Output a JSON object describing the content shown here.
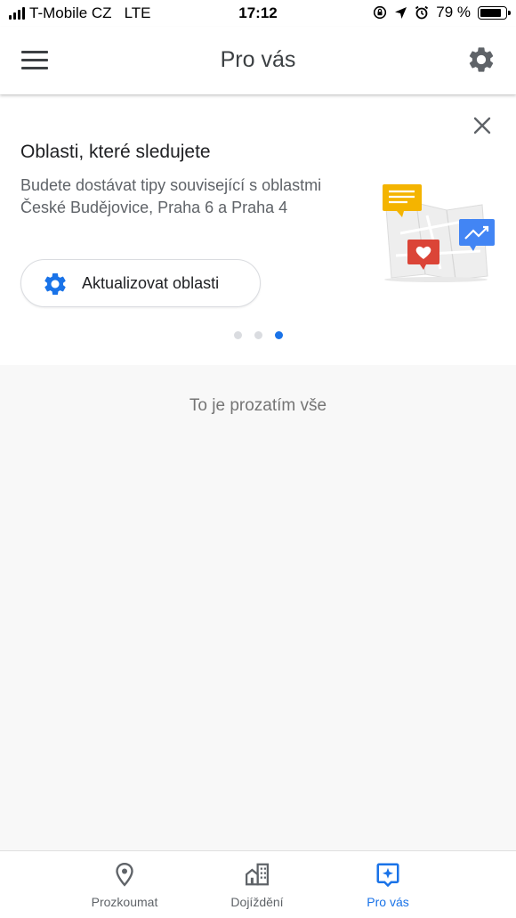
{
  "status_bar": {
    "carrier": "T-Mobile CZ",
    "network": "LTE",
    "time": "17:12",
    "battery": "79 %",
    "battery_level": 0.79
  },
  "app_bar": {
    "title": "Pro vás"
  },
  "card": {
    "title": "Oblasti, které sledujete",
    "description": "Budete dostávat tipy související s oblastmi České Budějovice, Praha 6 a Praha 4",
    "button_label": "Aktualizovat oblasti",
    "page_count": 3,
    "active_page": 3
  },
  "main": {
    "end_text": "To je prozatím vše"
  },
  "bottom_nav": {
    "items": [
      {
        "label": "Prozkoumat",
        "icon": "location-pin-icon"
      },
      {
        "label": "Dojíždění",
        "icon": "commute-buildings-icon"
      },
      {
        "label": "Pro vás",
        "icon": "for-you-sparkle-icon"
      }
    ],
    "active_index": 2
  },
  "colors": {
    "accent": "#1a73e8",
    "illustration_yellow": "#f4b400",
    "illustration_red": "#db4437",
    "illustration_blue": "#4285f4"
  }
}
